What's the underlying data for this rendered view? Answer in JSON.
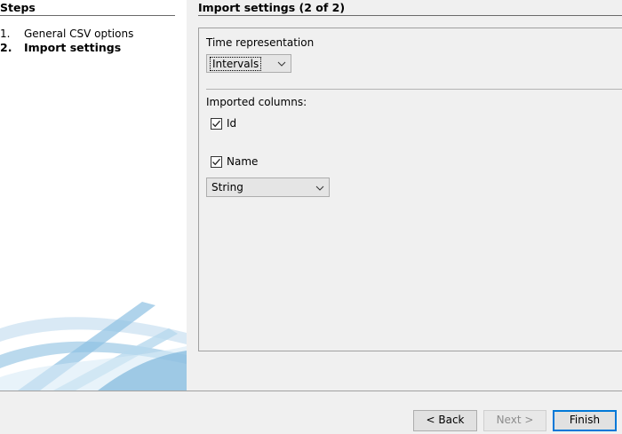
{
  "steps": {
    "title": "Steps",
    "items": [
      {
        "number": "1.",
        "label": "General CSV options",
        "current": false
      },
      {
        "number": "2.",
        "label": "Import settings",
        "current": true
      }
    ]
  },
  "header": {
    "title": "Import settings (2 of 2)"
  },
  "settings": {
    "time_label": "Time representation",
    "time_value": "Intervals",
    "columns_label": "Imported columns:",
    "columns": [
      {
        "label": "Id",
        "checked": true
      },
      {
        "label": "Name",
        "checked": true,
        "type": "String"
      }
    ]
  },
  "buttons": {
    "back": "< Back",
    "next": "Next >",
    "finish": "Finish"
  },
  "colors": {
    "accent": "#0078d7",
    "decor": "#7fb6db"
  }
}
